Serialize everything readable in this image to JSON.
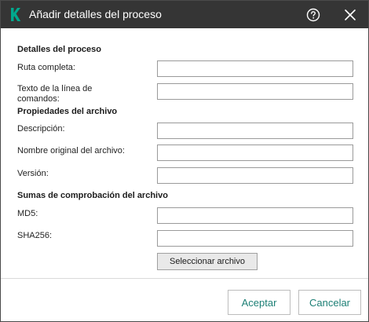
{
  "window": {
    "title": "Añadir detalles del proceso",
    "logo_icon": "kaspersky-k-logo",
    "help_icon": "help-circle-icon",
    "close_icon": "close-icon"
  },
  "process_details": {
    "heading": "Detalles del proceso",
    "full_path_label": "Ruta completa:",
    "full_path_value": "",
    "command_line_label_1": "Texto de la línea de",
    "command_line_label_2": "comandos:",
    "command_line_value": ""
  },
  "file_properties": {
    "heading": "Propiedades del archivo",
    "description_label": "Descripción:",
    "description_value": "",
    "original_name_label": "Nombre original del archivo:",
    "original_name_value": "",
    "version_label": "Versión:",
    "version_value": ""
  },
  "checksums": {
    "heading": "Sumas de comprobación del archivo",
    "md5_label": "MD5:",
    "md5_value": "",
    "sha256_label": "SHA256:",
    "sha256_value": "",
    "select_file_label": "Seleccionar archivo"
  },
  "footer": {
    "accept_label": "Aceptar",
    "cancel_label": "Cancelar"
  },
  "colors": {
    "titlebar": "#353535",
    "accent": "#1c7f75",
    "logo": "#00a88e"
  }
}
